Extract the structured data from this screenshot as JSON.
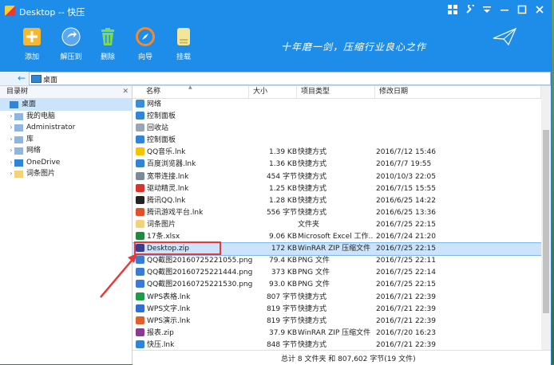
{
  "window": {
    "title": "Desktop -- 快压"
  },
  "toolbar": {
    "buttons": [
      {
        "label": "添加",
        "icon": "add-icon"
      },
      {
        "label": "解压到",
        "icon": "extract-icon"
      },
      {
        "label": "删除",
        "icon": "delete-icon"
      },
      {
        "label": "向导",
        "icon": "wizard-icon"
      },
      {
        "label": "挂载",
        "icon": "mount-icon"
      }
    ],
    "slogan": "十年磨一剑，压缩行业良心之作"
  },
  "address": {
    "path": "桌面"
  },
  "tree": {
    "header": "目录树",
    "close": "✕",
    "nodes": [
      {
        "label": "桌面",
        "level": 0,
        "expander": "",
        "selected": true
      },
      {
        "label": "我的电脑",
        "level": 1,
        "expander": "›"
      },
      {
        "label": "Administrator",
        "level": 1,
        "expander": "›"
      },
      {
        "label": "库",
        "level": 1,
        "expander": "›"
      },
      {
        "label": "网络",
        "level": 1,
        "expander": "›"
      },
      {
        "label": "OneDrive",
        "level": 1,
        "expander": "›"
      },
      {
        "label": "词条图片",
        "level": 1,
        "expander": "›"
      }
    ]
  },
  "list": {
    "columns": {
      "name": "名称",
      "size": "大小",
      "type": "项目类型",
      "modified": "修改日期"
    },
    "sort_indicator": "▲",
    "rows": [
      {
        "name": "网络",
        "size": "",
        "type": "",
        "modified": "",
        "color": "#3a8ed6"
      },
      {
        "name": "控制面板",
        "size": "",
        "type": "",
        "modified": "",
        "color": "#2f86d8"
      },
      {
        "name": "回收站",
        "size": "",
        "type": "",
        "modified": "",
        "color": "#9aa6b2"
      },
      {
        "name": "控制面板",
        "size": "",
        "type": "",
        "modified": "",
        "color": "#2f86d8"
      },
      {
        "name": "QQ音乐.lnk",
        "size": "1.39 KB",
        "type": "快捷方式",
        "modified": "2016/7/12 15:46",
        "color": "#f5c300"
      },
      {
        "name": "百度浏览器.lnk",
        "size": "1.36 KB",
        "type": "快捷方式",
        "modified": "2016/7/7 19:55",
        "color": "#2f86d8"
      },
      {
        "name": "宽带连接.lnk",
        "size": "454 字节",
        "type": "快捷方式",
        "modified": "2010/10/3 22:05",
        "color": "#7a8a9a"
      },
      {
        "name": "驱动精灵.lnk",
        "size": "1.25 KB",
        "type": "快捷方式",
        "modified": "2016/7/15 15:55",
        "color": "#d9342b"
      },
      {
        "name": "腾讯QQ.lnk",
        "size": "1.28 KB",
        "type": "快捷方式",
        "modified": "2016/6/25 14:22",
        "color": "#222222"
      },
      {
        "name": "腾讯游戏平台.lnk",
        "size": "556 字节",
        "type": "快捷方式",
        "modified": "2016/6/25 13:36",
        "color": "#e0502a"
      },
      {
        "name": "词条图片",
        "size": "",
        "type": "文件夹",
        "modified": "2016/7/25 22:15",
        "color": "#f3d27a"
      },
      {
        "name": "17条.xlsx",
        "size": "9.06 KB",
        "type": "Microsoft Excel 工作...",
        "modified": "2016/7/24 21:20",
        "color": "#1f8a3b"
      },
      {
        "name": "Desktop.zip",
        "size": "172 KB",
        "type": "WinRAR ZIP 压缩文件",
        "modified": "2016/7/25 22:15",
        "color": "#3b3b8f",
        "selected": true
      },
      {
        "name": "QQ截图20160725221055.png",
        "size": "79.4 KB",
        "type": "PNG 文件",
        "modified": "2016/7/25 22:11",
        "color": "#3a7bd5"
      },
      {
        "name": "QQ截图20160725221444.png",
        "size": "373 KB",
        "type": "PNG 文件",
        "modified": "2016/7/25 22:14",
        "color": "#3a7bd5"
      },
      {
        "name": "QQ截图20160725221530.png",
        "size": "93.0 KB",
        "type": "PNG 文件",
        "modified": "2016/7/25 22:15",
        "color": "#3a7bd5"
      },
      {
        "name": "WPS表格.lnk",
        "size": "807 字节",
        "type": "快捷方式",
        "modified": "2016/7/21 22:39",
        "color": "#1f9a4a"
      },
      {
        "name": "WPS文字.lnk",
        "size": "819 字节",
        "type": "快捷方式",
        "modified": "2016/7/21 22:39",
        "color": "#2f6fd6"
      },
      {
        "name": "WPS演示.lnk",
        "size": "819 字节",
        "type": "快捷方式",
        "modified": "2016/7/21 22:39",
        "color": "#e0602a"
      },
      {
        "name": "报表.zip",
        "size": "37.9 KB",
        "type": "WinRAR ZIP 压缩文件",
        "modified": "2016/7/20 16:23",
        "color": "#8a3b8f"
      },
      {
        "name": "快压.lnk",
        "size": "848 字节",
        "type": "快捷方式",
        "modified": "2016/7/21 22:39",
        "color": "#2f86d8"
      }
    ]
  },
  "status": {
    "text": "总计 8 文件夹 和 807,602 字节(19 文件)"
  },
  "colors": {
    "accent": "#1d8de9",
    "selection": "#cce4fb",
    "annotation": "#e23b3b"
  }
}
